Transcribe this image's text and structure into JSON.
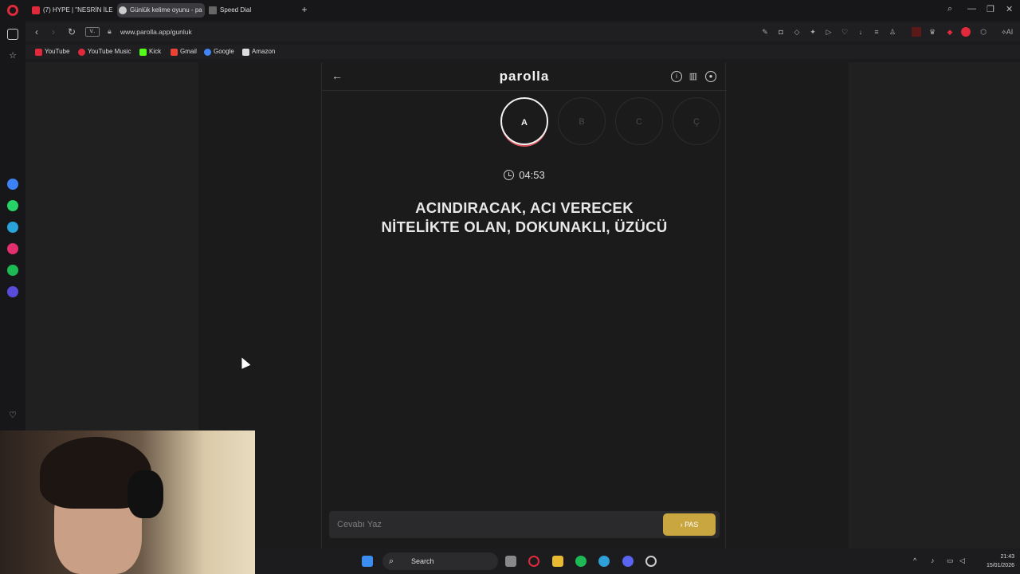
{
  "browser": {
    "tabs": [
      {
        "label": "(7) HYPE | \"NESRİN İLE PA",
        "active": false,
        "icon_color": "#e0293a"
      },
      {
        "label": "Günlük kelime oyunu - pa",
        "active": true,
        "icon_color": "#cccccc"
      },
      {
        "label": "Speed Dial",
        "active": false,
        "icon_color": "#888888"
      }
    ],
    "url": "www.parolla.app/gunluk",
    "url_badge": "V..",
    "bookmarks": [
      {
        "label": "YouTube",
        "icon_color": "#e0293a"
      },
      {
        "label": "YouTube Music",
        "icon_color": "#e0293a"
      },
      {
        "label": "Kick",
        "icon_color": "#53fc18"
      },
      {
        "label": "Gmail",
        "icon_color": "#ea4335"
      },
      {
        "label": "Google",
        "icon_color": "#4285f4"
      },
      {
        "label": "Amazon",
        "icon_color": "#dddddd"
      }
    ]
  },
  "game": {
    "logo": "parolla",
    "letters": [
      {
        "char": "A",
        "active": true
      },
      {
        "char": "B",
        "active": false
      },
      {
        "char": "C",
        "active": false
      },
      {
        "char": "Ç",
        "active": false
      }
    ],
    "timer": "04:53",
    "clue_line1": "ACINDIRACAK, ACI VERECEK",
    "clue_line2": "NİTELİKTE OLAN, DOKUNAKLI, ÜZÜCÜ",
    "answer_placeholder": "Cevabı Yaz",
    "pass_label": "PAS",
    "accent_color": "#c9a640"
  },
  "taskbar": {
    "search_label": "Search",
    "time": "21:43",
    "date": "15/01/2026"
  }
}
